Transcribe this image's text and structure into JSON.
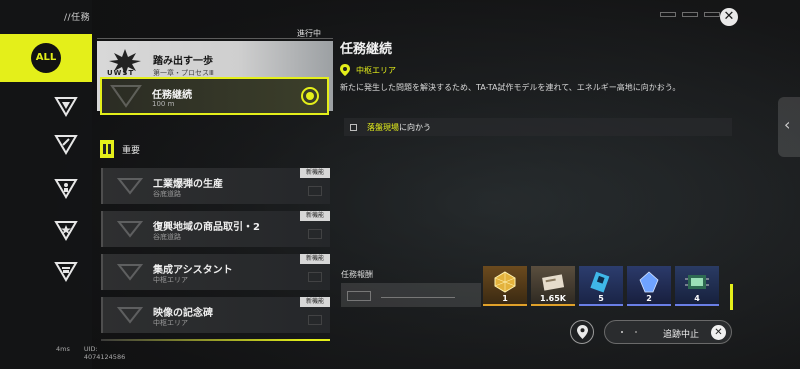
{
  "topbar": {
    "breadcrumb": "//任務"
  },
  "close_icon": "close-icon",
  "rail": {
    "all_label": "ALL",
    "icons": [
      "main-quest-icon",
      "side-quest-icon",
      "character-quest-icon",
      "star-quest-icon",
      "commission-quest-icon"
    ]
  },
  "list": {
    "status_tab": "進行中",
    "main_card": {
      "logo_text": "UWST",
      "title": "踏み出す一歩",
      "subtitle": "第一章・プロセスⅢ"
    },
    "active_card": {
      "title": "任務継続",
      "distance": "100 m"
    },
    "section_label": "重要",
    "items": [
      {
        "title": "工業爆弾の生産",
        "subtitle": "谷底道路",
        "tag": "新機能"
      },
      {
        "title": "復興地域の商品取引・2",
        "subtitle": "谷底道路",
        "tag": "新機能"
      },
      {
        "title": "集成アシスタント",
        "subtitle": "中枢エリア",
        "tag": "新機能"
      },
      {
        "title": "映像の記念碑",
        "subtitle": "中枢エリア",
        "tag": "新機能"
      }
    ]
  },
  "detail": {
    "title": "任務継続",
    "location": "中枢エリア",
    "description": "新たに発生した問題を解決するため、TA-TA試作モデルを連れて、エネルギー高地に向かおう。",
    "objective_highlight": "落盤現場",
    "objective_rest": "に向かう"
  },
  "rewards": {
    "label": "任務報酬",
    "items": [
      {
        "qty": "1",
        "icon": "gold-crystal-icon"
      },
      {
        "qty": "1.65K",
        "icon": "credit-ticket-icon"
      },
      {
        "qty": "5",
        "icon": "blue-card-icon"
      },
      {
        "qty": "2",
        "icon": "blue-crystal-icon"
      },
      {
        "qty": "4",
        "icon": "chip-module-icon"
      }
    ]
  },
  "footer": {
    "track_stop_label": "追跡中止",
    "ping": "4ms",
    "uid": "UID: 4074124586"
  },
  "colors": {
    "accent": "#e4ef1a",
    "panel": "#2e2f30"
  }
}
